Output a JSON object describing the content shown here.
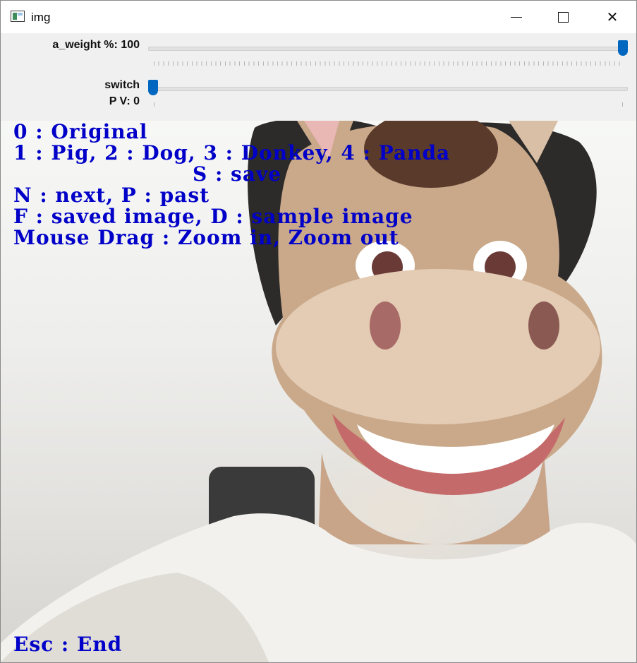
{
  "window": {
    "title": "img",
    "controls": {
      "minimize": "minimize",
      "maximize": "maximize",
      "close": "close"
    }
  },
  "trackbars": [
    {
      "label": "a_weight %: 100",
      "value": 100,
      "max": 100
    },
    {
      "label_line1": "switch",
      "label_line2": "P V: 0",
      "value": 0,
      "max": 1
    }
  ],
  "overlay": {
    "line0": "0 : Original",
    "line1": "1 : Pig, 2 : Dog, 3 : Donkey, 4 : Panda",
    "line2": "S : save",
    "line3": "N : next, P : past",
    "line4": "F : saved image, D : sample image",
    "line5": "Mouse Drag : Zoom in, Zoom out",
    "footer": "Esc : End"
  },
  "colors": {
    "overlay_text": "#0000c8",
    "thumb": "#0067c0"
  }
}
